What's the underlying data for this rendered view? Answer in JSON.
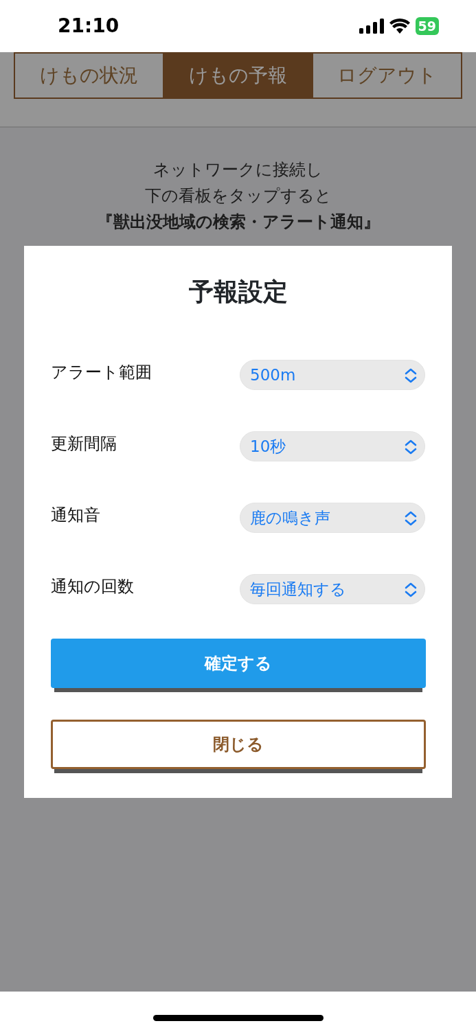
{
  "status_bar": {
    "time": "21:10",
    "battery": "59"
  },
  "tabs": [
    {
      "label": "けもの状況",
      "selected": false
    },
    {
      "label": "けもの予報",
      "selected": true
    },
    {
      "label": "ログアウト",
      "selected": false
    }
  ],
  "intro": [
    {
      "text": "ネットワークに接続し",
      "kind": "plain"
    },
    {
      "text": "下の看板をタップすると",
      "kind": "plain"
    },
    {
      "text": "『獣出没地域の検索・アラート通知』",
      "kind": "emphasis"
    }
  ],
  "modal": {
    "title": "予報設定",
    "settings": [
      {
        "label": "アラート範囲",
        "value": "500m"
      },
      {
        "label": "更新間隔",
        "value": "10秒"
      },
      {
        "label": "通知音",
        "value": "鹿の鳴き声"
      },
      {
        "label": "通知の回数",
        "value": "毎回通知する"
      }
    ],
    "buttons": [
      {
        "label": "確定する",
        "kind": "primary"
      },
      {
        "label": "閉じる",
        "kind": "outline"
      }
    ]
  }
}
